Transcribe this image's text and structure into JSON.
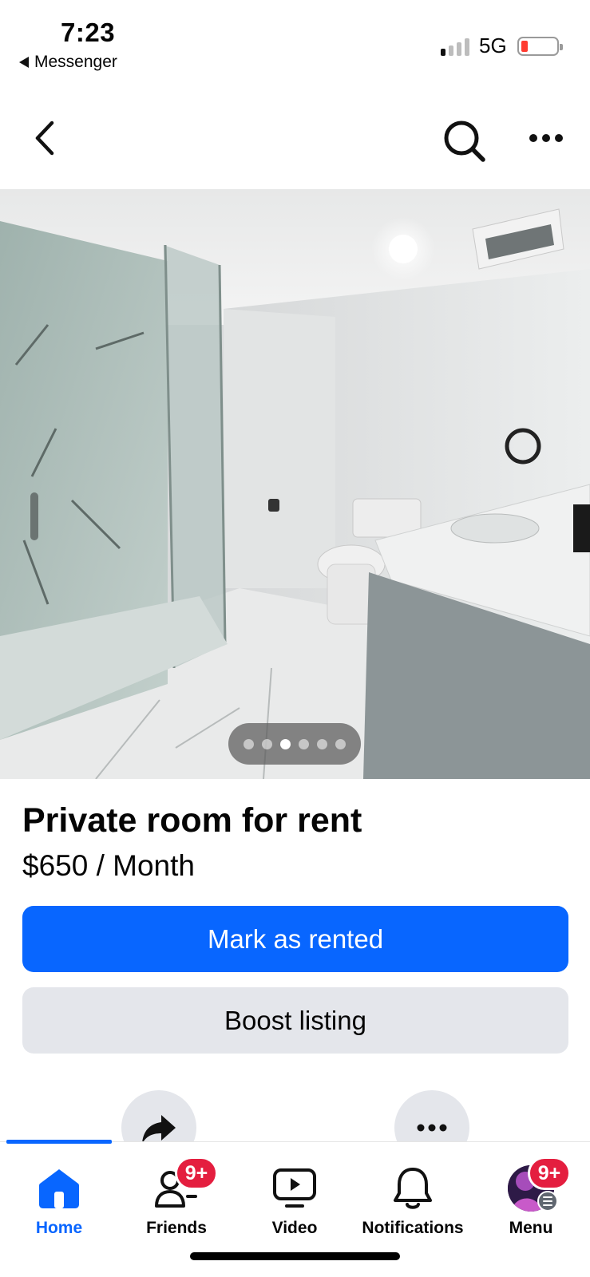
{
  "status_bar": {
    "time": "7:23",
    "back_app": "Messenger",
    "network": "5G",
    "battery_level": 0.1
  },
  "listing": {
    "title": "Private room for rent",
    "price": "$650 / Month",
    "photo_count": 6,
    "active_photo_index": 2
  },
  "actions": {
    "mark_rented_label": "Mark as rented",
    "boost_label": "Boost listing"
  },
  "tabs": [
    {
      "label": "Home",
      "icon": "home-icon",
      "active": true
    },
    {
      "label": "Friends",
      "icon": "friends-icon",
      "badge": "9+"
    },
    {
      "label": "Video",
      "icon": "video-icon"
    },
    {
      "label": "Notifications",
      "icon": "bell-icon"
    },
    {
      "label": "Menu",
      "icon": "avatar",
      "badge": "9+"
    }
  ],
  "colors": {
    "primary": "#0866ff",
    "secondary_bg": "#e4e6eb",
    "badge": "#e41e3f"
  }
}
